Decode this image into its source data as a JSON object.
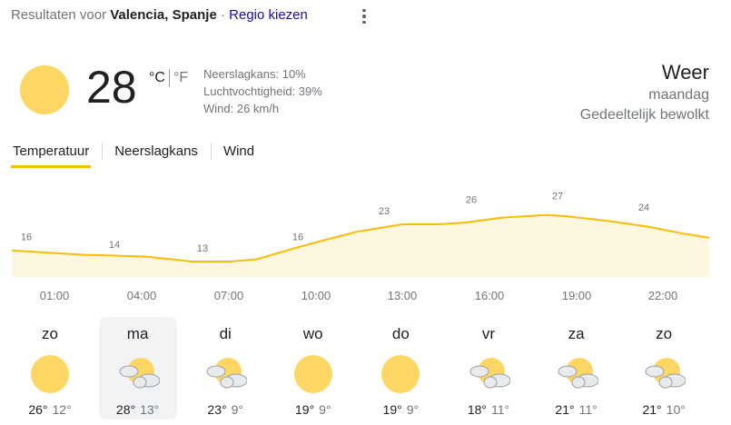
{
  "header": {
    "prefix": "Resultaten voor ",
    "location": "Valencia, Spanje",
    "separator": " · ",
    "region_link": "Regio kiezen",
    "more_icon": "more-vert-icon"
  },
  "current": {
    "icon": "sunny-icon",
    "temperature": "28",
    "unit_c": "°C",
    "unit_f": "°F",
    "precipitation": "Neerslagkans: 10%",
    "humidity": "Luchtvochtigheid: 39%",
    "wind": "Wind: 26 km/h",
    "title": "Weer",
    "day": "maandag",
    "condition": "Gedeeltelijk bewolkt"
  },
  "tabs": [
    {
      "label": "Temperatuur",
      "active": true
    },
    {
      "label": "Neerslagkans"
    },
    {
      "label": "Wind"
    }
  ],
  "chart_data": {
    "type": "area",
    "x": [
      "01:00",
      "04:00",
      "07:00",
      "10:00",
      "13:00",
      "16:00",
      "19:00",
      "22:00"
    ],
    "values": [
      16,
      14,
      13,
      16,
      23,
      26,
      27,
      24
    ],
    "color": "#fbbc04",
    "fill": "#fef7e0"
  },
  "days": [
    {
      "name": "zo",
      "icon": "sunny-icon",
      "max": "26°",
      "min": "12°"
    },
    {
      "name": "ma",
      "icon": "partly-cloudy-icon",
      "max": "28°",
      "min": "13°",
      "selected": true
    },
    {
      "name": "di",
      "icon": "partly-cloudy-icon",
      "max": "23°",
      "min": "9°"
    },
    {
      "name": "wo",
      "icon": "sunny-icon",
      "max": "19°",
      "min": "9°"
    },
    {
      "name": "do",
      "icon": "sunny-icon",
      "max": "19°",
      "min": "9°"
    },
    {
      "name": "vr",
      "icon": "partly-cloudy-icon",
      "max": "18°",
      "min": "11°"
    },
    {
      "name": "za",
      "icon": "partly-cloudy-icon",
      "max": "21°",
      "min": "11°"
    },
    {
      "name": "zo",
      "icon": "partly-cloudy-icon",
      "max": "21°",
      "min": "10°"
    }
  ]
}
